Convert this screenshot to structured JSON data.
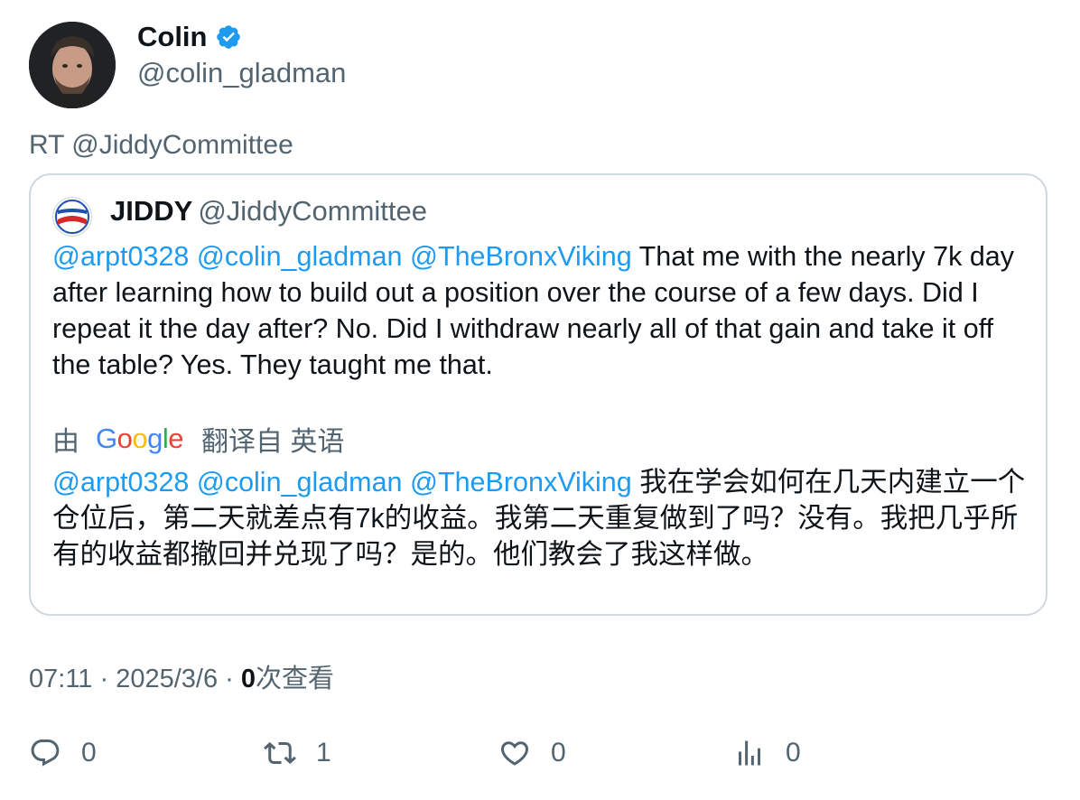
{
  "tweet": {
    "author_name": "Colin",
    "author_handle": "@colin_gladman",
    "retweet_line": "RT @JiddyCommittee"
  },
  "quote": {
    "name": "JIDDY",
    "handle": "@JiddyCommittee",
    "mentions": [
      "@arpt0328",
      "@colin_gladman",
      "@TheBronxViking"
    ],
    "text": "That me with the nearly 7k day after learning how to build out a position over the course of a few days. Did I repeat it the day after? No. Did I withdraw nearly all of that gain and take it off the table? Yes. They taught me that.",
    "translate_prefix": "由",
    "translate_brand": "Google",
    "translate_suffix": "翻译自 英语",
    "translated_text": "我在学会如何在几天内建立一个仓位后，第二天就差点有7k的收益。我第二天重复做到了吗？没有。我把几乎所有的收益都撤回并兑现了吗？是的。他们教会了我这样做。"
  },
  "meta": {
    "time": "07:11",
    "date": "2025/3/6",
    "separator": "·",
    "views_count": "0",
    "views_label": "次查看"
  },
  "actions": {
    "reply_count": "0",
    "retweet_count": "1",
    "like_count": "0",
    "views_count": "0"
  },
  "colors": {
    "accent": "#1d9bf0",
    "secondary_text": "#536471",
    "border": "#cfd9de"
  },
  "icons": [
    "verified-badge-icon",
    "reply-icon",
    "retweet-icon",
    "like-icon",
    "views-icon"
  ]
}
